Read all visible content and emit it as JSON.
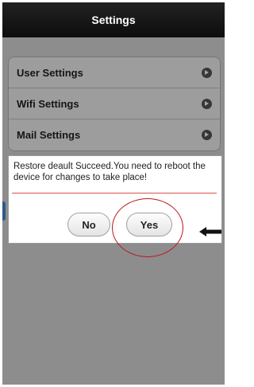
{
  "header": {
    "title": "Settings"
  },
  "menu": {
    "items": [
      {
        "label": "User Settings"
      },
      {
        "label": "Wifi Settings"
      },
      {
        "label": "Mail Settings"
      }
    ]
  },
  "dialog": {
    "message": "Restore deault Succeed.You need to reboot the device for changes to take place!",
    "no_label": "No",
    "yes_label": "Yes"
  },
  "annotation": {
    "circle_color": "#c0161e",
    "arrow_icon": "arrow-left-icon"
  }
}
